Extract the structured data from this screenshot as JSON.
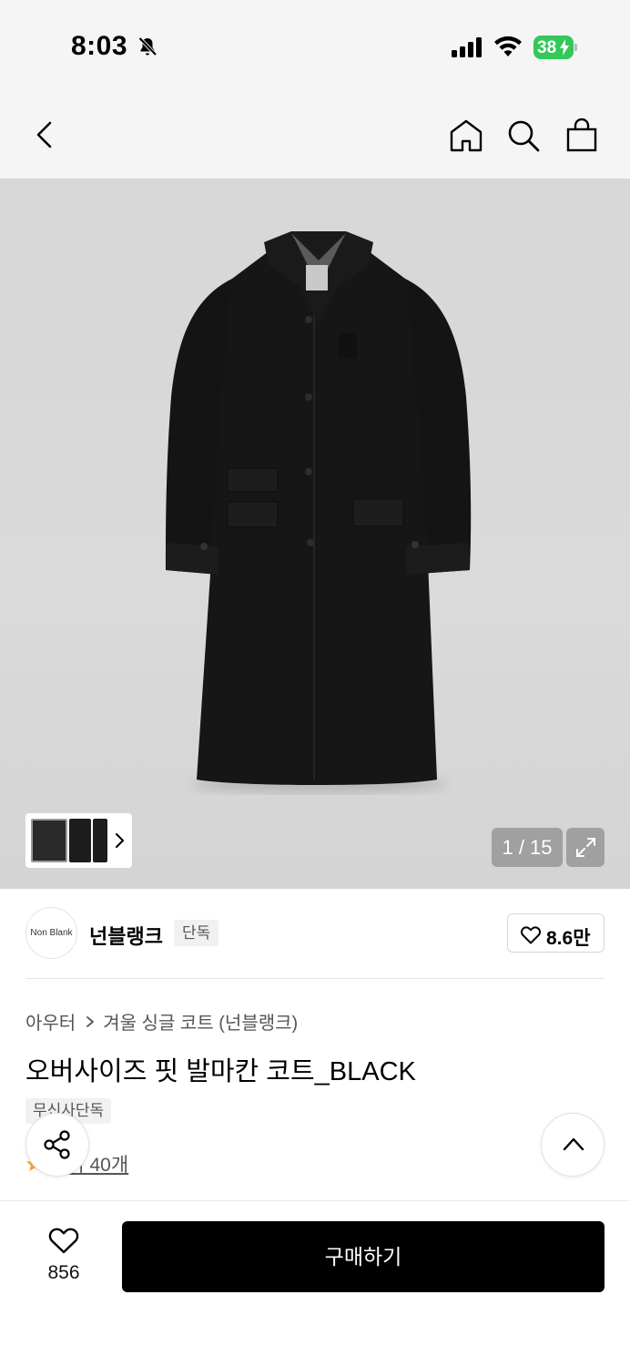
{
  "status_bar": {
    "time": "8:03",
    "battery_level": "38",
    "battery_color": "#34c759"
  },
  "header": {
    "icons": [
      "back-icon",
      "home-icon",
      "search-icon",
      "shopping-bag-icon"
    ]
  },
  "gallery": {
    "page_counter": "1 / 15",
    "thumbnail_count": 3,
    "expand_icon": "expand-icon"
  },
  "brand": {
    "logo_text": "Non Blank",
    "name": "넌블랭크",
    "badge": "단독",
    "like_count": "8.6만"
  },
  "product": {
    "breadcrumb": [
      "아우터",
      "겨울 싱글 코트 (넌블랭크)"
    ],
    "title": "오버사이즈 핏 발마칸 코트_BLACK",
    "tag": "무신사단독",
    "review_text": "후기 40개"
  },
  "floating": {
    "share_icon": "share-icon",
    "top_icon": "chevron-up-icon"
  },
  "bottom_bar": {
    "wish_count": "856",
    "buy_label": "구매하기",
    "buy_color": "#000000"
  }
}
